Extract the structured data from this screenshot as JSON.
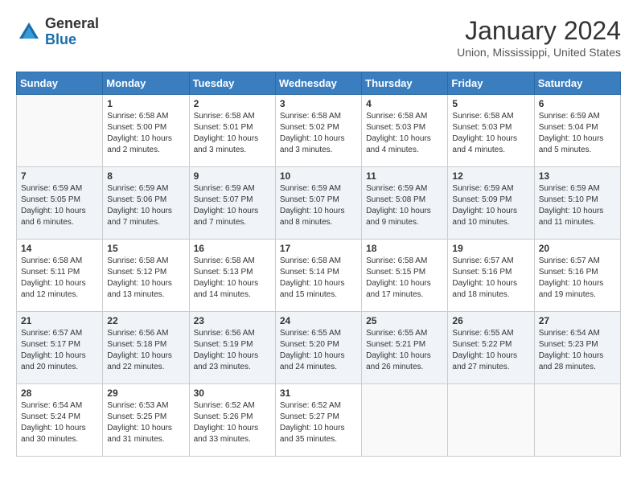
{
  "header": {
    "logo_general": "General",
    "logo_blue": "Blue",
    "month_year": "January 2024",
    "location": "Union, Mississippi, United States"
  },
  "days_of_week": [
    "Sunday",
    "Monday",
    "Tuesday",
    "Wednesday",
    "Thursday",
    "Friday",
    "Saturday"
  ],
  "weeks": [
    [
      {
        "num": "",
        "info": ""
      },
      {
        "num": "1",
        "info": "Sunrise: 6:58 AM\nSunset: 5:00 PM\nDaylight: 10 hours\nand 2 minutes."
      },
      {
        "num": "2",
        "info": "Sunrise: 6:58 AM\nSunset: 5:01 PM\nDaylight: 10 hours\nand 3 minutes."
      },
      {
        "num": "3",
        "info": "Sunrise: 6:58 AM\nSunset: 5:02 PM\nDaylight: 10 hours\nand 3 minutes."
      },
      {
        "num": "4",
        "info": "Sunrise: 6:58 AM\nSunset: 5:03 PM\nDaylight: 10 hours\nand 4 minutes."
      },
      {
        "num": "5",
        "info": "Sunrise: 6:58 AM\nSunset: 5:03 PM\nDaylight: 10 hours\nand 4 minutes."
      },
      {
        "num": "6",
        "info": "Sunrise: 6:59 AM\nSunset: 5:04 PM\nDaylight: 10 hours\nand 5 minutes."
      }
    ],
    [
      {
        "num": "7",
        "info": "Sunrise: 6:59 AM\nSunset: 5:05 PM\nDaylight: 10 hours\nand 6 minutes."
      },
      {
        "num": "8",
        "info": "Sunrise: 6:59 AM\nSunset: 5:06 PM\nDaylight: 10 hours\nand 7 minutes."
      },
      {
        "num": "9",
        "info": "Sunrise: 6:59 AM\nSunset: 5:07 PM\nDaylight: 10 hours\nand 7 minutes."
      },
      {
        "num": "10",
        "info": "Sunrise: 6:59 AM\nSunset: 5:07 PM\nDaylight: 10 hours\nand 8 minutes."
      },
      {
        "num": "11",
        "info": "Sunrise: 6:59 AM\nSunset: 5:08 PM\nDaylight: 10 hours\nand 9 minutes."
      },
      {
        "num": "12",
        "info": "Sunrise: 6:59 AM\nSunset: 5:09 PM\nDaylight: 10 hours\nand 10 minutes."
      },
      {
        "num": "13",
        "info": "Sunrise: 6:59 AM\nSunset: 5:10 PM\nDaylight: 10 hours\nand 11 minutes."
      }
    ],
    [
      {
        "num": "14",
        "info": "Sunrise: 6:58 AM\nSunset: 5:11 PM\nDaylight: 10 hours\nand 12 minutes."
      },
      {
        "num": "15",
        "info": "Sunrise: 6:58 AM\nSunset: 5:12 PM\nDaylight: 10 hours\nand 13 minutes."
      },
      {
        "num": "16",
        "info": "Sunrise: 6:58 AM\nSunset: 5:13 PM\nDaylight: 10 hours\nand 14 minutes."
      },
      {
        "num": "17",
        "info": "Sunrise: 6:58 AM\nSunset: 5:14 PM\nDaylight: 10 hours\nand 15 minutes."
      },
      {
        "num": "18",
        "info": "Sunrise: 6:58 AM\nSunset: 5:15 PM\nDaylight: 10 hours\nand 17 minutes."
      },
      {
        "num": "19",
        "info": "Sunrise: 6:57 AM\nSunset: 5:16 PM\nDaylight: 10 hours\nand 18 minutes."
      },
      {
        "num": "20",
        "info": "Sunrise: 6:57 AM\nSunset: 5:16 PM\nDaylight: 10 hours\nand 19 minutes."
      }
    ],
    [
      {
        "num": "21",
        "info": "Sunrise: 6:57 AM\nSunset: 5:17 PM\nDaylight: 10 hours\nand 20 minutes."
      },
      {
        "num": "22",
        "info": "Sunrise: 6:56 AM\nSunset: 5:18 PM\nDaylight: 10 hours\nand 22 minutes."
      },
      {
        "num": "23",
        "info": "Sunrise: 6:56 AM\nSunset: 5:19 PM\nDaylight: 10 hours\nand 23 minutes."
      },
      {
        "num": "24",
        "info": "Sunrise: 6:55 AM\nSunset: 5:20 PM\nDaylight: 10 hours\nand 24 minutes."
      },
      {
        "num": "25",
        "info": "Sunrise: 6:55 AM\nSunset: 5:21 PM\nDaylight: 10 hours\nand 26 minutes."
      },
      {
        "num": "26",
        "info": "Sunrise: 6:55 AM\nSunset: 5:22 PM\nDaylight: 10 hours\nand 27 minutes."
      },
      {
        "num": "27",
        "info": "Sunrise: 6:54 AM\nSunset: 5:23 PM\nDaylight: 10 hours\nand 28 minutes."
      }
    ],
    [
      {
        "num": "28",
        "info": "Sunrise: 6:54 AM\nSunset: 5:24 PM\nDaylight: 10 hours\nand 30 minutes."
      },
      {
        "num": "29",
        "info": "Sunrise: 6:53 AM\nSunset: 5:25 PM\nDaylight: 10 hours\nand 31 minutes."
      },
      {
        "num": "30",
        "info": "Sunrise: 6:52 AM\nSunset: 5:26 PM\nDaylight: 10 hours\nand 33 minutes."
      },
      {
        "num": "31",
        "info": "Sunrise: 6:52 AM\nSunset: 5:27 PM\nDaylight: 10 hours\nand 35 minutes."
      },
      {
        "num": "",
        "info": ""
      },
      {
        "num": "",
        "info": ""
      },
      {
        "num": "",
        "info": ""
      }
    ]
  ]
}
